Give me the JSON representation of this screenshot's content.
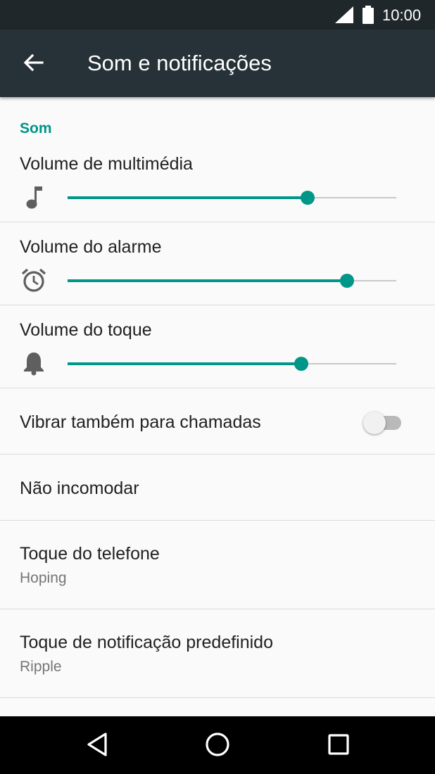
{
  "status_bar": {
    "time": "10:00",
    "icons": [
      "signal-icon",
      "battery-icon"
    ]
  },
  "app_bar": {
    "back_icon": "arrow-back-icon",
    "title": "Som e notificações"
  },
  "section": {
    "header": "Som"
  },
  "volumes": [
    {
      "label": "Volume de multimédia",
      "icon": "music-note-icon",
      "level_percent": 73
    },
    {
      "label": "Volume do alarme",
      "icon": "alarm-clock-icon",
      "level_percent": 85
    },
    {
      "label": "Volume do toque",
      "icon": "bell-icon",
      "level_percent": 71
    }
  ],
  "vibrate": {
    "label": "Vibrar também para chamadas",
    "enabled": false
  },
  "dnd": {
    "label": "Não incomodar"
  },
  "ringtone": {
    "label": "Toque do telefone",
    "value": "Hoping"
  },
  "notification_sound": {
    "label": "Toque de notificação predefinido",
    "value": "Ripple"
  },
  "nav_bar": {
    "icons": [
      "back-triangle-icon",
      "home-circle-icon",
      "recents-square-icon"
    ]
  },
  "colors": {
    "accent": "#009688",
    "app_bar": "#263238",
    "status_bar": "#1f272b",
    "background": "#fafafa",
    "divider": "#dcdcdc"
  }
}
